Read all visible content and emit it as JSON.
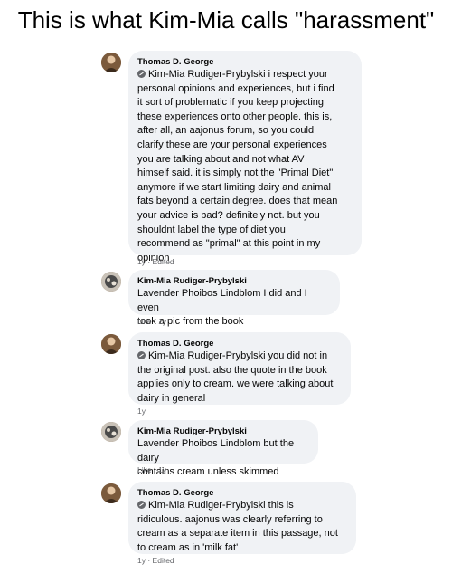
{
  "title": "This is what Kim-Mia calls \"harassment\"",
  "comments": [
    {
      "author": "Thomas D. George",
      "mention": "Kim-Mia Rudiger-Prybylski",
      "lines": [
        " i respect your",
        "personal opinions and experiences, but i find",
        "it sort of problematic if you keep projecting",
        "these experiences onto other people. this is,",
        "after all, an aajonus forum, so you could",
        "clarify these are your personal experiences",
        "you are talking about and not what AV",
        "himself said. it is simply not the \"Primal Diet\"",
        "anymore if we start limiting dairy and animal",
        "fats beyond a certain degree. does that mean",
        "your advice is bad? definitely not. but you",
        "shouldnt label the type of diet you",
        "recommend as \"primal\" at this point in my",
        "opinion"
      ],
      "meta_a": "1y",
      "meta_sep": " · ",
      "meta_b": "Edited"
    },
    {
      "author": "Kim-Mia Rudiger-Prybylski",
      "lines": [
        "Lavender Phoibos Lindblom I did and I even",
        "took a pic from the book"
      ],
      "meta_a": "Like",
      "meta_sep": " · ",
      "meta_b": "1y"
    },
    {
      "author": "Thomas D. George",
      "mention": "Kim-Mia Rudiger-Prybylski",
      "lines": [
        " you did not in",
        "the original post. also the quote in the book",
        "applies only to cream. we were talking about",
        "dairy in general"
      ],
      "meta_a": "1y"
    },
    {
      "author": "Kim-Mia Rudiger-Prybylski",
      "lines": [
        "Lavender Phoibos Lindblom but the dairy",
        "contains cream unless skimmed"
      ],
      "meta_a": "Like",
      "meta_sep": " · ",
      "meta_b": "1y"
    },
    {
      "author": "Thomas D. George",
      "mention": "Kim-Mia Rudiger-Prybylski",
      "lines": [
        " this is",
        "ridiculous. aajonus was clearly referring to",
        "cream as a separate item in this passage, not",
        "to cream as in 'milk fat'"
      ],
      "meta_a": "1y",
      "meta_sep": " · ",
      "meta_b": "Edited"
    }
  ]
}
